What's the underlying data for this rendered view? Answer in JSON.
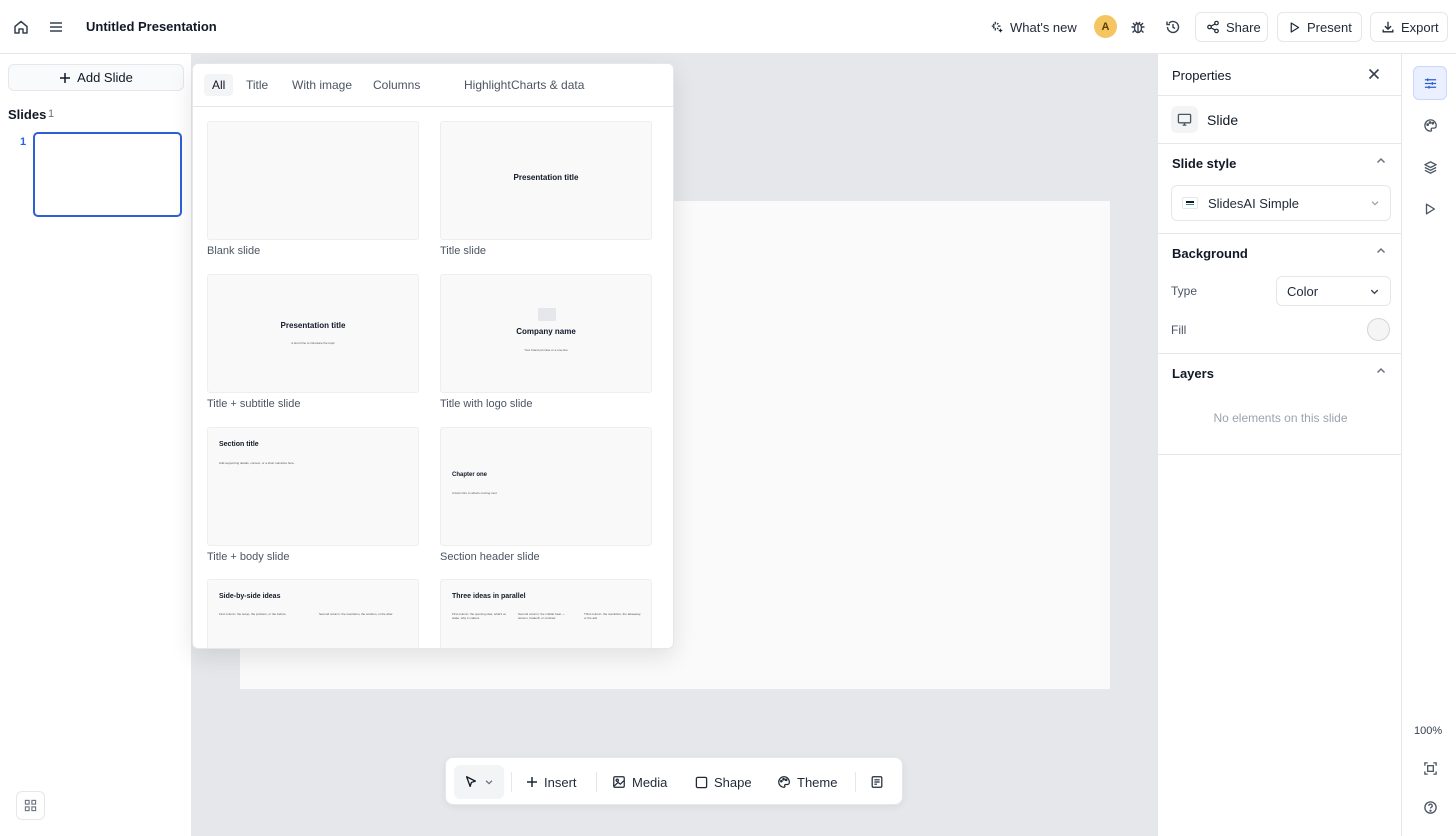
{
  "topbar": {
    "title": "Untitled Presentation",
    "whats_new": "What's new",
    "avatar_initial": "A",
    "share": "Share",
    "present": "Present",
    "export": "Export"
  },
  "sidebar": {
    "add_slide": "Add Slide",
    "slides_label": "Slides",
    "slides_count": "1",
    "slide_number": "1"
  },
  "layouts": {
    "tabs": [
      "All",
      "Title",
      "With image",
      "Columns",
      "Highlight",
      "Charts & data"
    ],
    "active_tab": "All",
    "tiles": [
      {
        "label": "Blank slide"
      },
      {
        "label": "Title slide",
        "title": "Presentation title"
      },
      {
        "label": "Title + subtitle slide",
        "title": "Presentation title",
        "subtitle": "A short line to introduce the topic"
      },
      {
        "label": "Title with logo slide",
        "title": "Company name",
        "subtitle": "Your brand promise or a one-line"
      },
      {
        "label": "Title + body slide",
        "title": "Section title",
        "body": "Add supporting details, context, or a short narrative here."
      },
      {
        "label": "Section header slide",
        "title": "Chapter one",
        "body": "A brief intro to what's coming next"
      },
      {
        "label": "",
        "title": "Side-by-side ideas",
        "col1": "First column: the setup, the problem, or the before.",
        "col2": "Second column: the resolution, the solution, or the after."
      },
      {
        "label": "",
        "title": "Three ideas in parallel",
        "col1": "First column: the opening idea, what's at stake, why it matters",
        "col2": "Second column: the middle beat — tension, tradeoff, or contrast",
        "col3": "Third column: the resolution, the takeaway, or the ask"
      }
    ]
  },
  "toolbar": {
    "insert": "Insert",
    "media": "Media",
    "shape": "Shape",
    "theme": "Theme"
  },
  "properties": {
    "title": "Properties",
    "element_type": "Slide",
    "slide_style_label": "Slide style",
    "slide_style_value": "SlidesAI Simple",
    "background_label": "Background",
    "type_label": "Type",
    "type_value": "Color",
    "fill_label": "Fill",
    "layers_label": "Layers",
    "layers_empty": "No elements on this slide"
  },
  "rail": {
    "zoom": "100%"
  }
}
